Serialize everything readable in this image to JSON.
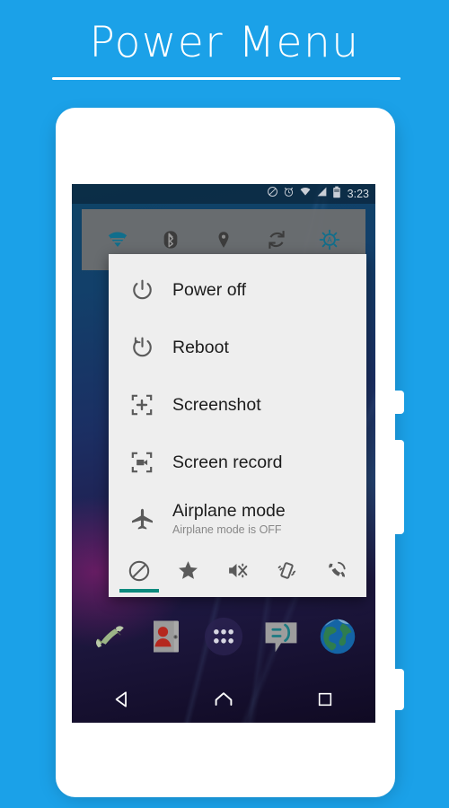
{
  "header": {
    "title": "Power Menu",
    "accent_blue": "#1BA1E8",
    "rule_color": "#FFFFFF"
  },
  "phone": {
    "body_color": "#FFFFFF",
    "side_buttons": [
      {
        "name": "power-side-button"
      },
      {
        "name": "volume-side-button"
      },
      {
        "name": "camera-side-button"
      }
    ]
  },
  "status_bar": {
    "time": "3:23",
    "icons": [
      {
        "name": "do-not-disturb-icon"
      },
      {
        "name": "alarm-icon"
      },
      {
        "name": "wifi-icon"
      },
      {
        "name": "signal-icon"
      },
      {
        "name": "battery-icon"
      }
    ]
  },
  "quick_settings": {
    "active_color": "#10708C",
    "inactive_color": "#3C3C3C",
    "items": [
      {
        "name": "wifi-toggle",
        "state": "on"
      },
      {
        "name": "bluetooth-toggle",
        "state": "off"
      },
      {
        "name": "location-toggle",
        "state": "off"
      },
      {
        "name": "sync-toggle",
        "state": "off"
      },
      {
        "name": "auto-brightness-toggle",
        "state": "on"
      }
    ]
  },
  "power_dialog": {
    "background": "#EEEEEE",
    "accent": "#0D8A7D",
    "items": [
      {
        "icon": "power-icon",
        "label": "Power off",
        "sub": ""
      },
      {
        "icon": "reboot-icon",
        "label": "Reboot",
        "sub": ""
      },
      {
        "icon": "screenshot-icon",
        "label": "Screenshot",
        "sub": ""
      },
      {
        "icon": "screen-record-icon",
        "label": "Screen record",
        "sub": ""
      },
      {
        "icon": "airplane-icon",
        "label": "Airplane mode",
        "sub": "Airplane mode is OFF"
      }
    ],
    "mode_tabs": [
      {
        "name": "do-not-disturb-mode-tab",
        "selected": true
      },
      {
        "name": "priority-mode-tab",
        "selected": false
      },
      {
        "name": "silent-mode-tab",
        "selected": false
      },
      {
        "name": "vibrate-mode-tab",
        "selected": false
      },
      {
        "name": "ring-mode-tab",
        "selected": false
      }
    ]
  },
  "dock": {
    "items": [
      {
        "name": "phone-app-icon"
      },
      {
        "name": "contacts-app-icon"
      },
      {
        "name": "app-drawer-icon"
      },
      {
        "name": "messaging-app-icon"
      },
      {
        "name": "browser-app-icon"
      }
    ]
  },
  "nav_bar": {
    "items": [
      {
        "name": "back-nav-button"
      },
      {
        "name": "home-nav-button"
      },
      {
        "name": "recents-nav-button"
      }
    ]
  }
}
